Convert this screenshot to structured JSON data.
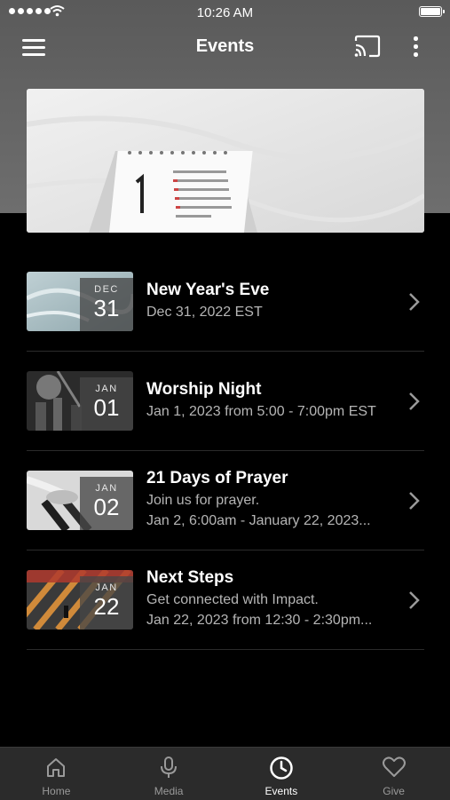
{
  "status_bar": {
    "time": "10:26 AM"
  },
  "nav": {
    "title": "Events"
  },
  "events": [
    {
      "month": "DEC",
      "day": "31",
      "title": "New Year's Eve",
      "lines": [
        "Dec 31, 2022 EST"
      ]
    },
    {
      "month": "JAN",
      "day": "01",
      "title": "Worship Night",
      "lines": [
        "Jan 1, 2023 from 5:00 - 7:00pm EST"
      ]
    },
    {
      "month": "JAN",
      "day": "02",
      "title": "21 Days of Prayer",
      "lines": [
        "Join us for prayer.",
        "Jan 2, 6:00am - January 22, 2023..."
      ]
    },
    {
      "month": "JAN",
      "day": "22",
      "title": "Next Steps",
      "lines": [
        "Get connected with Impact.",
        "Jan 22, 2023 from 12:30 - 2:30pm..."
      ]
    }
  ],
  "tabs": [
    {
      "label": "Home",
      "icon": "home-icon",
      "active": false
    },
    {
      "label": "Media",
      "icon": "microphone-icon",
      "active": false
    },
    {
      "label": "Events",
      "icon": "clock-icon",
      "active": true
    },
    {
      "label": "Give",
      "icon": "heart-icon",
      "active": false
    }
  ],
  "colors": {
    "background": "#000000",
    "tab_bar": "#2b2b2b",
    "active_tab": "#ffffff",
    "inactive_tab": "#9a9a9a"
  }
}
